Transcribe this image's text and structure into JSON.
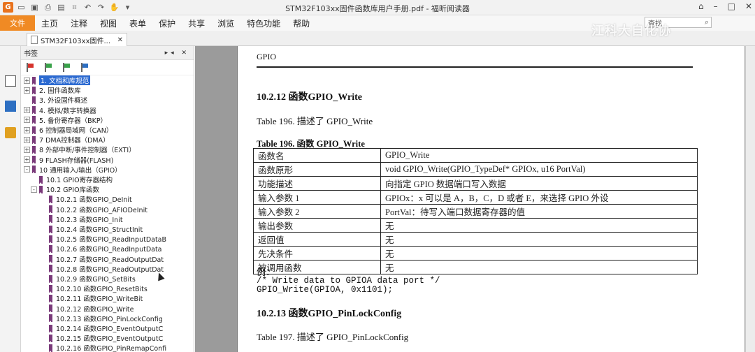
{
  "window": {
    "title": "STM32F103xx固件函数库用户手册.pdf - 福昕阅读器"
  },
  "menu": {
    "file": "文件",
    "items": [
      "主页",
      "注释",
      "视图",
      "表单",
      "保护",
      "共享",
      "浏览",
      "特色功能",
      "帮助"
    ],
    "search_placeholder": "查找",
    "watermark": "江科大自化协"
  },
  "tab": {
    "label": "STM32F103xx固件..."
  },
  "bookmarks": {
    "title": "书签",
    "items": [
      {
        "label": "1. 文档和库规范",
        "level": 0,
        "expand": "+",
        "selected": true
      },
      {
        "label": "2. 固件函数库",
        "level": 0,
        "expand": "+"
      },
      {
        "label": "3. 外设固件概述",
        "level": 0,
        "expand": ""
      },
      {
        "label": "4. 模拟/数字转换器",
        "level": 0,
        "expand": "+"
      },
      {
        "label": "5. 备份寄存器（BKP）",
        "level": 0,
        "expand": "+"
      },
      {
        "label": "6 控制器局域网（CAN）",
        "level": 0,
        "expand": "+"
      },
      {
        "label": "7  DMA控制器（DMA）",
        "level": 0,
        "expand": "+"
      },
      {
        "label": "8 外部中断/事件控制器（EXTI）",
        "level": 0,
        "expand": "+"
      },
      {
        "label": "9 FLASH存储器(FLASH)",
        "level": 0,
        "expand": "+"
      },
      {
        "label": "10 通用输入/输出（GPIO）",
        "level": 0,
        "expand": "-"
      },
      {
        "label": "10.1 GPIO寄存器结构",
        "level": 1,
        "expand": ""
      },
      {
        "label": "10.2 GPIO库函数",
        "level": 1,
        "expand": "-"
      },
      {
        "label": "10.2.1 函数GPIO_DeInit",
        "level": 2,
        "expand": ""
      },
      {
        "label": "10.2.2 函数GPIO_AFIODeInit",
        "level": 2,
        "expand": ""
      },
      {
        "label": "10.2.3 函数GPIO_Init",
        "level": 2,
        "expand": ""
      },
      {
        "label": "10.2.4 函数GPIO_StructInit",
        "level": 2,
        "expand": ""
      },
      {
        "label": "10.2.5 函数GPIO_ReadInputDataB",
        "level": 2,
        "expand": ""
      },
      {
        "label": "10.2.6 函数GPIO_ReadInputData",
        "level": 2,
        "expand": ""
      },
      {
        "label": "10.2.7 函数GPIO_ReadOutputDat",
        "level": 2,
        "expand": ""
      },
      {
        "label": "10.2.8 函数GPIO_ReadOutputDat",
        "level": 2,
        "expand": ""
      },
      {
        "label": "10.2.9 函数GPIO_SetBits",
        "level": 2,
        "expand": ""
      },
      {
        "label": "10.2.10 函数GPIO_ResetBits",
        "level": 2,
        "expand": ""
      },
      {
        "label": "10.2.11 函数GPIO_WriteBit",
        "level": 2,
        "expand": ""
      },
      {
        "label": "10.2.12 函数GPIO_Write",
        "level": 2,
        "expand": ""
      },
      {
        "label": "10.2.13 函数GPIO_PinLockConfig",
        "level": 2,
        "expand": ""
      },
      {
        "label": "10.2.14 函数GPIO_EventOutputC",
        "level": 2,
        "expand": ""
      },
      {
        "label": "10.2.15 函数GPIO_EventOutputC",
        "level": 2,
        "expand": ""
      },
      {
        "label": "10.2.16 函数GPIO_PinRemapConfi",
        "level": 2,
        "expand": ""
      }
    ]
  },
  "page": {
    "header": "GPIO",
    "section1_title": "10.2.12  函数GPIO_Write",
    "section1_desc": "Table 196.  描述了 GPIO_Write",
    "table_caption": "Table 196.  函数 GPIO_Write",
    "table": [
      [
        "函数名",
        "GPIO_Write"
      ],
      [
        "函数原形",
        "void GPIO_Write(GPIO_TypeDef* GPIOx, u16 PortVal)"
      ],
      [
        "功能描述",
        "向指定 GPIO 数据端口写入数据"
      ],
      [
        "输入参数 1",
        "GPIOx：x 可以是 A，B，C，D 或者 E，来选择 GPIO 外设"
      ],
      [
        "输入参数 2",
        "PortVal：待写入端口数据寄存器的值"
      ],
      [
        "输出参数",
        "无"
      ],
      [
        "返回值",
        "无"
      ],
      [
        "先决条件",
        "无"
      ],
      [
        "被调用函数",
        "无"
      ]
    ],
    "example_label": "例：",
    "code_line1": "/* Write data to GPIOA data port */",
    "code_line2": "GPIO_Write(GPIOA, 0x1101);",
    "section2_title": "10.2.13  函数GPIO_PinLockConfig",
    "section2_desc": "Table 197.  描述了 GPIO_PinLockConfig"
  }
}
